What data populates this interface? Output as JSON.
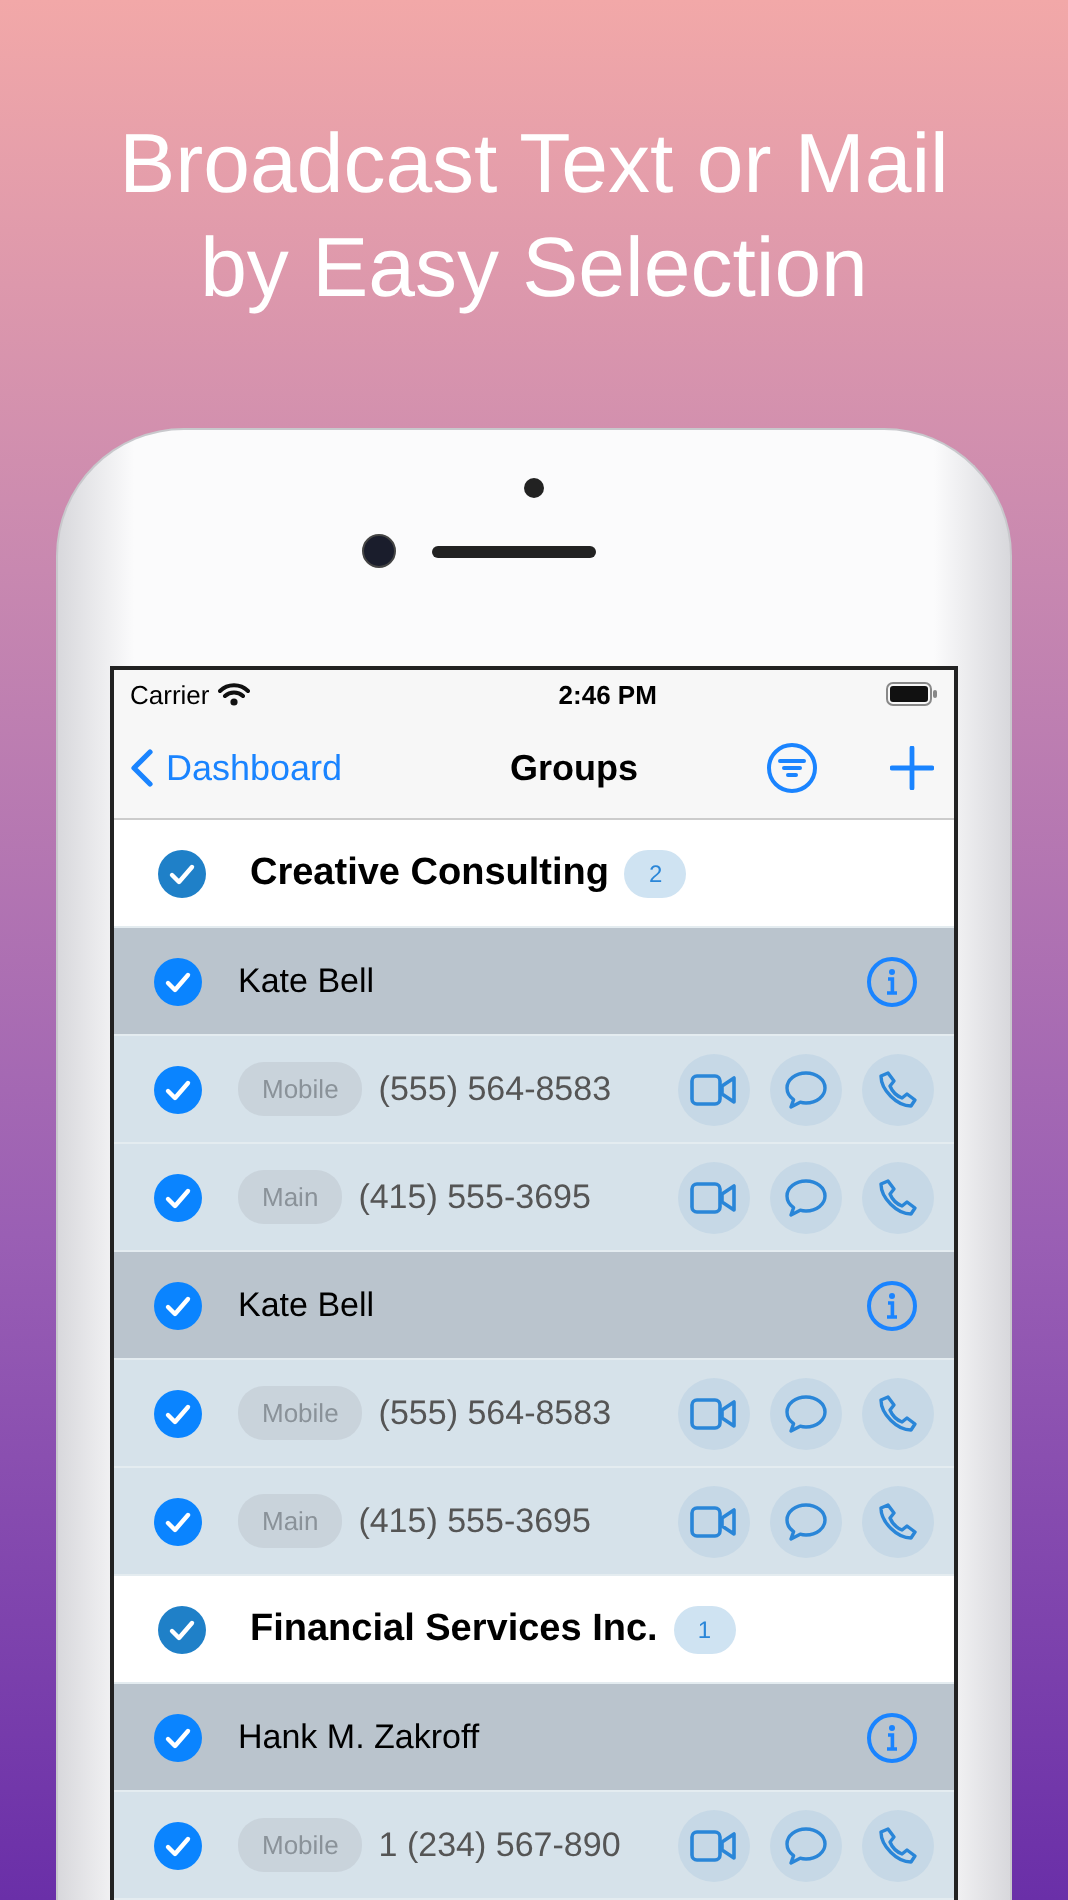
{
  "headline": [
    "Broadcast Text or Mail",
    "by Easy Selection"
  ],
  "status_bar": {
    "carrier": "Carrier",
    "time": "2:46 PM"
  },
  "nav": {
    "back": "Dashboard",
    "title": "Groups"
  },
  "rows": [
    {
      "kind": "group",
      "checked": true,
      "name": "Creative Consulting",
      "count": "2"
    },
    {
      "kind": "contact",
      "checked": true,
      "name": "Kate Bell"
    },
    {
      "kind": "phone",
      "checked": true,
      "label": "Mobile",
      "number": "(555) 564-8583"
    },
    {
      "kind": "phone",
      "checked": true,
      "label": "Main",
      "number": "(415) 555-3695"
    },
    {
      "kind": "contact",
      "checked": true,
      "name": "Kate Bell"
    },
    {
      "kind": "phone",
      "checked": true,
      "label": "Mobile",
      "number": "(555) 564-8583"
    },
    {
      "kind": "phone",
      "checked": true,
      "label": "Main",
      "number": "(415) 555-3695"
    },
    {
      "kind": "group",
      "checked": true,
      "name": "Financial Services Inc.",
      "count": "1"
    },
    {
      "kind": "contact",
      "checked": true,
      "name": "Hank M. Zakroff"
    },
    {
      "kind": "phone",
      "checked": true,
      "label": "Mobile",
      "number": "1 (234) 567-890"
    }
  ]
}
